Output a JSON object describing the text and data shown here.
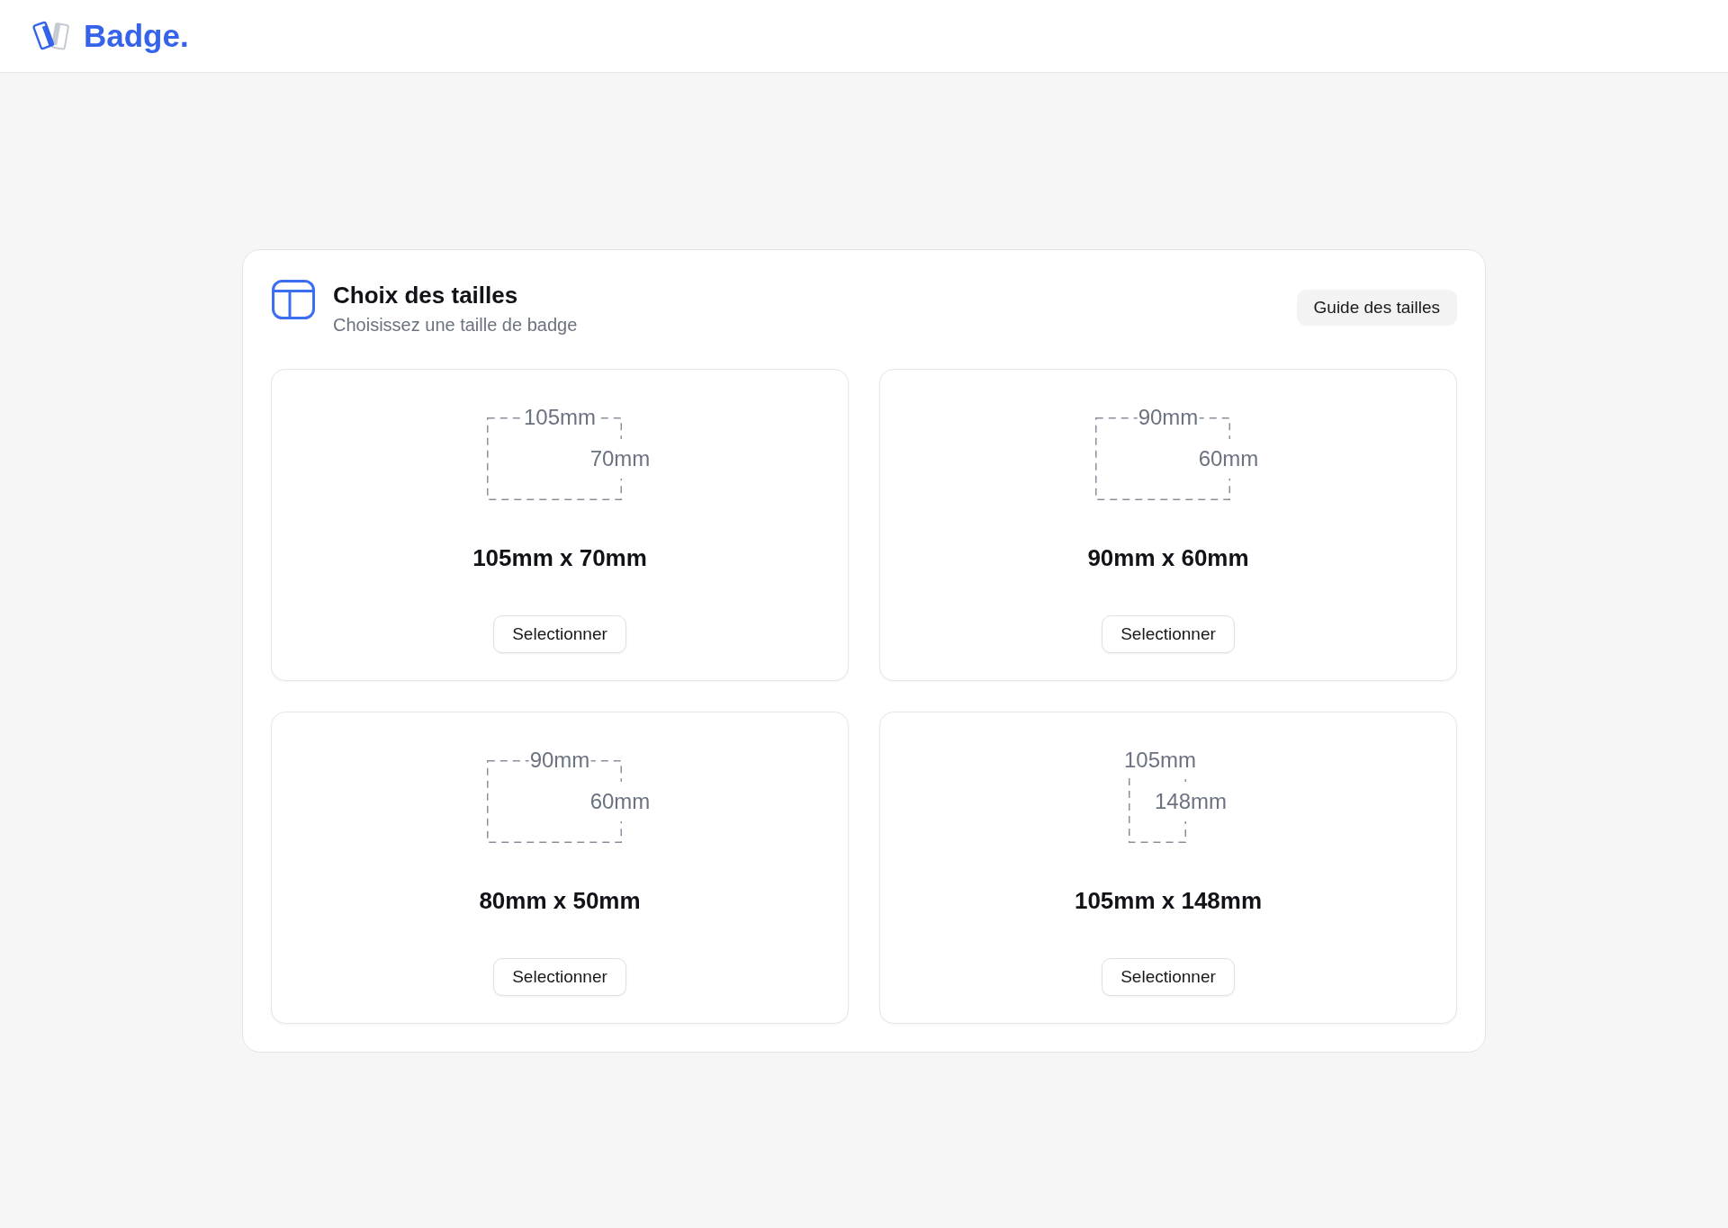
{
  "header": {
    "logo_text": "Badge."
  },
  "panel": {
    "title": "Choix des tailles",
    "subtitle": "Choisissez une taille de badge",
    "guide_button": "Guide des tailles"
  },
  "sizes": [
    {
      "kind": "landscape",
      "width_label": "105mm",
      "height_label": "70mm",
      "title": "105mm x 70mm",
      "button": "Selectionner"
    },
    {
      "kind": "landscape",
      "width_label": "90mm",
      "height_label": "60mm",
      "title": "90mm x 60mm",
      "button": "Selectionner"
    },
    {
      "kind": "landscape",
      "width_label": "90mm",
      "height_label": "60mm",
      "title": "80mm x 50mm",
      "button": "Selectionner"
    },
    {
      "kind": "portrait",
      "width_label": "105mm",
      "height_label": "148mm",
      "title": "105mm x 148mm",
      "button": "Selectionner"
    }
  ]
}
